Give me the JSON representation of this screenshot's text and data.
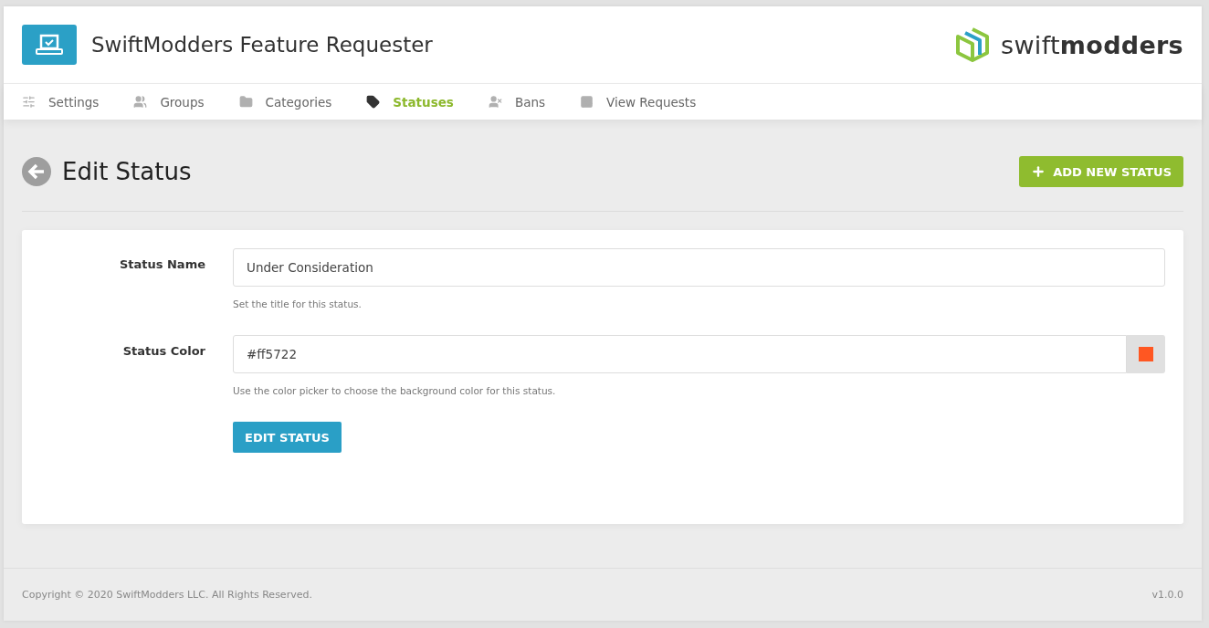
{
  "header": {
    "title": "SwiftModders Feature Requester",
    "brand": {
      "light": "swift",
      "bold": "modders"
    }
  },
  "nav": [
    {
      "label": "Settings",
      "kind": "settings",
      "selected": false
    },
    {
      "label": "Groups",
      "kind": "groups",
      "selected": false
    },
    {
      "label": "Categories",
      "kind": "categories",
      "selected": false
    },
    {
      "label": "Statuses",
      "kind": "statuses",
      "selected": true
    },
    {
      "label": "Bans",
      "kind": "bans",
      "selected": false
    },
    {
      "label": "View Requests",
      "kind": "requests",
      "selected": false
    }
  ],
  "page": {
    "title": "Edit Status",
    "add_button": "ADD NEW STATUS"
  },
  "form": {
    "fields": [
      {
        "kind": "text",
        "label": "Status Name",
        "value": "Under Consideration",
        "help": "Set the title for this status."
      },
      {
        "kind": "color",
        "label": "Status Color",
        "value": "#ff5722",
        "help": "Use the color picker to choose the background color for this status."
      }
    ],
    "submit": "EDIT STATUS"
  },
  "footer": {
    "copyright": "Copyright © 2020 SwiftModders LLC. All Rights Reserved.",
    "version": "v1.0.0"
  }
}
